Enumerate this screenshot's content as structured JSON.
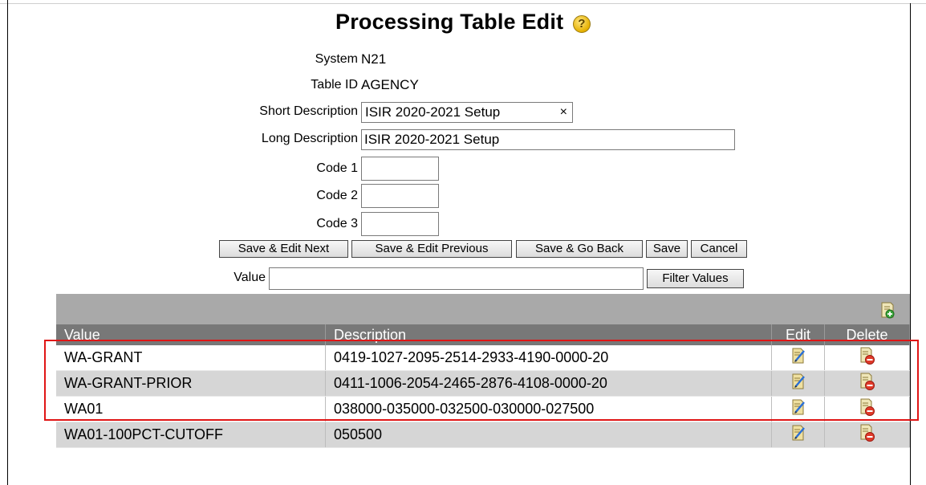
{
  "page": {
    "title": "Processing Table Edit",
    "help_glyph": "?"
  },
  "form": {
    "system_label": "System",
    "system_value": "N21",
    "table_id_label": "Table ID",
    "table_id_value": "AGENCY",
    "short_desc_label": "Short Description",
    "short_desc_value": "ISIR 2020-2021 Setup",
    "short_desc_clear": "×",
    "long_desc_label": "Long Description",
    "long_desc_value": "ISIR 2020-2021 Setup",
    "code1_label": "Code 1",
    "code1_value": "",
    "code2_label": "Code 2",
    "code2_value": "",
    "code3_label": "Code 3",
    "code3_value": ""
  },
  "actions": {
    "save_edit_next": "Save & Edit Next",
    "save_edit_previous": "Save & Edit Previous",
    "save_go_back": "Save & Go Back",
    "save": "Save",
    "cancel": "Cancel"
  },
  "filter": {
    "label": "Value",
    "value": "",
    "button": "Filter Values"
  },
  "grid": {
    "columns": [
      "Value",
      "Description",
      "Edit",
      "Delete"
    ],
    "rows": [
      {
        "value": "WA-GRANT",
        "description": "0419-1027-2095-2514-2933-4190-0000-20"
      },
      {
        "value": "WA-GRANT-PRIOR",
        "description": "0411-1006-2054-2465-2876-4108-0000-20"
      },
      {
        "value": "WA01",
        "description": "038000-035000-032500-030000-027500"
      },
      {
        "value": "WA01-100PCT-CUTOFF",
        "description": "050500"
      }
    ]
  },
  "colors": {
    "grid_header": "#787878",
    "grid_toolbar": "#a9a9a9",
    "row_alt": "#d6d6d6",
    "highlight": "#e01515"
  }
}
